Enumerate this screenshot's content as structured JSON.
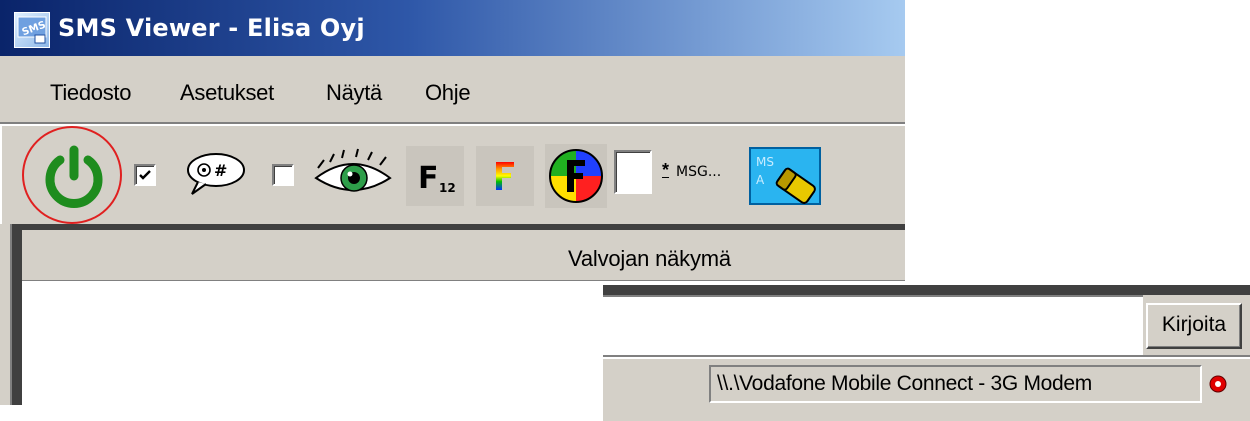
{
  "window": {
    "title": "SMS Viewer - Elisa Oyj",
    "app_icon": "sms-app-icon"
  },
  "menu": {
    "items": [
      {
        "label": "Tiedosto"
      },
      {
        "label": "Asetukset"
      },
      {
        "label": "Näytä"
      },
      {
        "label": "Ohje"
      }
    ]
  },
  "toolbar": {
    "power": {
      "icon": "power-icon",
      "color": "#1e8c1e",
      "highlight_color": "#e02020"
    },
    "checkbox_1": {
      "checked": true
    },
    "message_filter": {
      "icon": "speech-bubble-hash-icon"
    },
    "checkbox_2": {
      "checked": false
    },
    "monitor_view": {
      "icon": "eye-icon"
    },
    "font_size": {
      "icon": "font-12-icon",
      "letter": "F",
      "subscript": "12"
    },
    "font_color": {
      "icon": "font-color-icon",
      "letter": "F"
    },
    "font_palette": {
      "icon": "color-wheel-font-icon",
      "letter": "F"
    },
    "checkbox_3": {
      "checked": false
    },
    "msg_button": {
      "label": "MSG...",
      "prefix": "*"
    },
    "msa_button": {
      "icon": "msa-eraser-icon",
      "text": "MS A"
    }
  },
  "panel": {
    "header": "Valvojan näkymä"
  },
  "compose": {
    "input_value": "",
    "send_label": "Kirjoita"
  },
  "statusbar": {
    "connection": "\\\\.\\Vodafone Mobile Connect - 3G Modem",
    "indicator": {
      "icon": "status-led-icon",
      "color": "#e00000"
    }
  }
}
